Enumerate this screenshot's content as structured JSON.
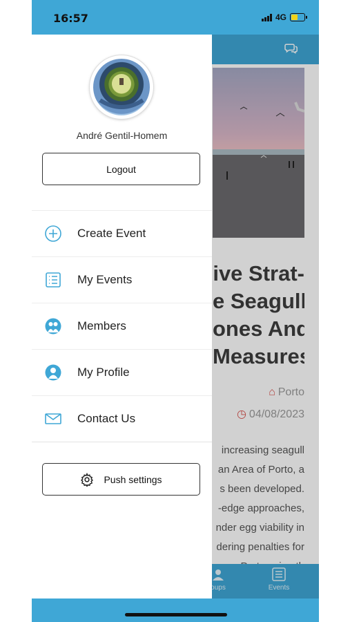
{
  "status_bar": {
    "time": "16:57",
    "network": "4G"
  },
  "drawer": {
    "user_name": "André Gentil-Homem",
    "logout_label": "Logout",
    "menu": [
      {
        "label": "Create Event",
        "icon": "plus-circle-icon"
      },
      {
        "label": "My Events",
        "icon": "list-icon"
      },
      {
        "label": "Members",
        "icon": "members-icon"
      },
      {
        "label": "My Profile",
        "icon": "profile-icon"
      },
      {
        "label": "Contact Us",
        "icon": "mail-icon"
      }
    ],
    "push_settings_label": "Push settings"
  },
  "article": {
    "headline_lines": [
      "ive Strat-",
      "e Seagull",
      "ones And",
      "Measures"
    ],
    "location": "Porto",
    "date": "04/08/2023",
    "body_lines": [
      "increasing seagull",
      "an Area of Porto, a",
      "s been developed.",
      "-edge approaches,",
      "nder egg viability in",
      "dering penalties for",
      "Porto using th"
    ]
  },
  "tabbar": {
    "tab_left_partial": "oups",
    "tab_events": "Events"
  },
  "colors": {
    "accent": "#3fa7d6",
    "icon_blue": "#3fa7d6",
    "meta_red": "#d9534f"
  }
}
